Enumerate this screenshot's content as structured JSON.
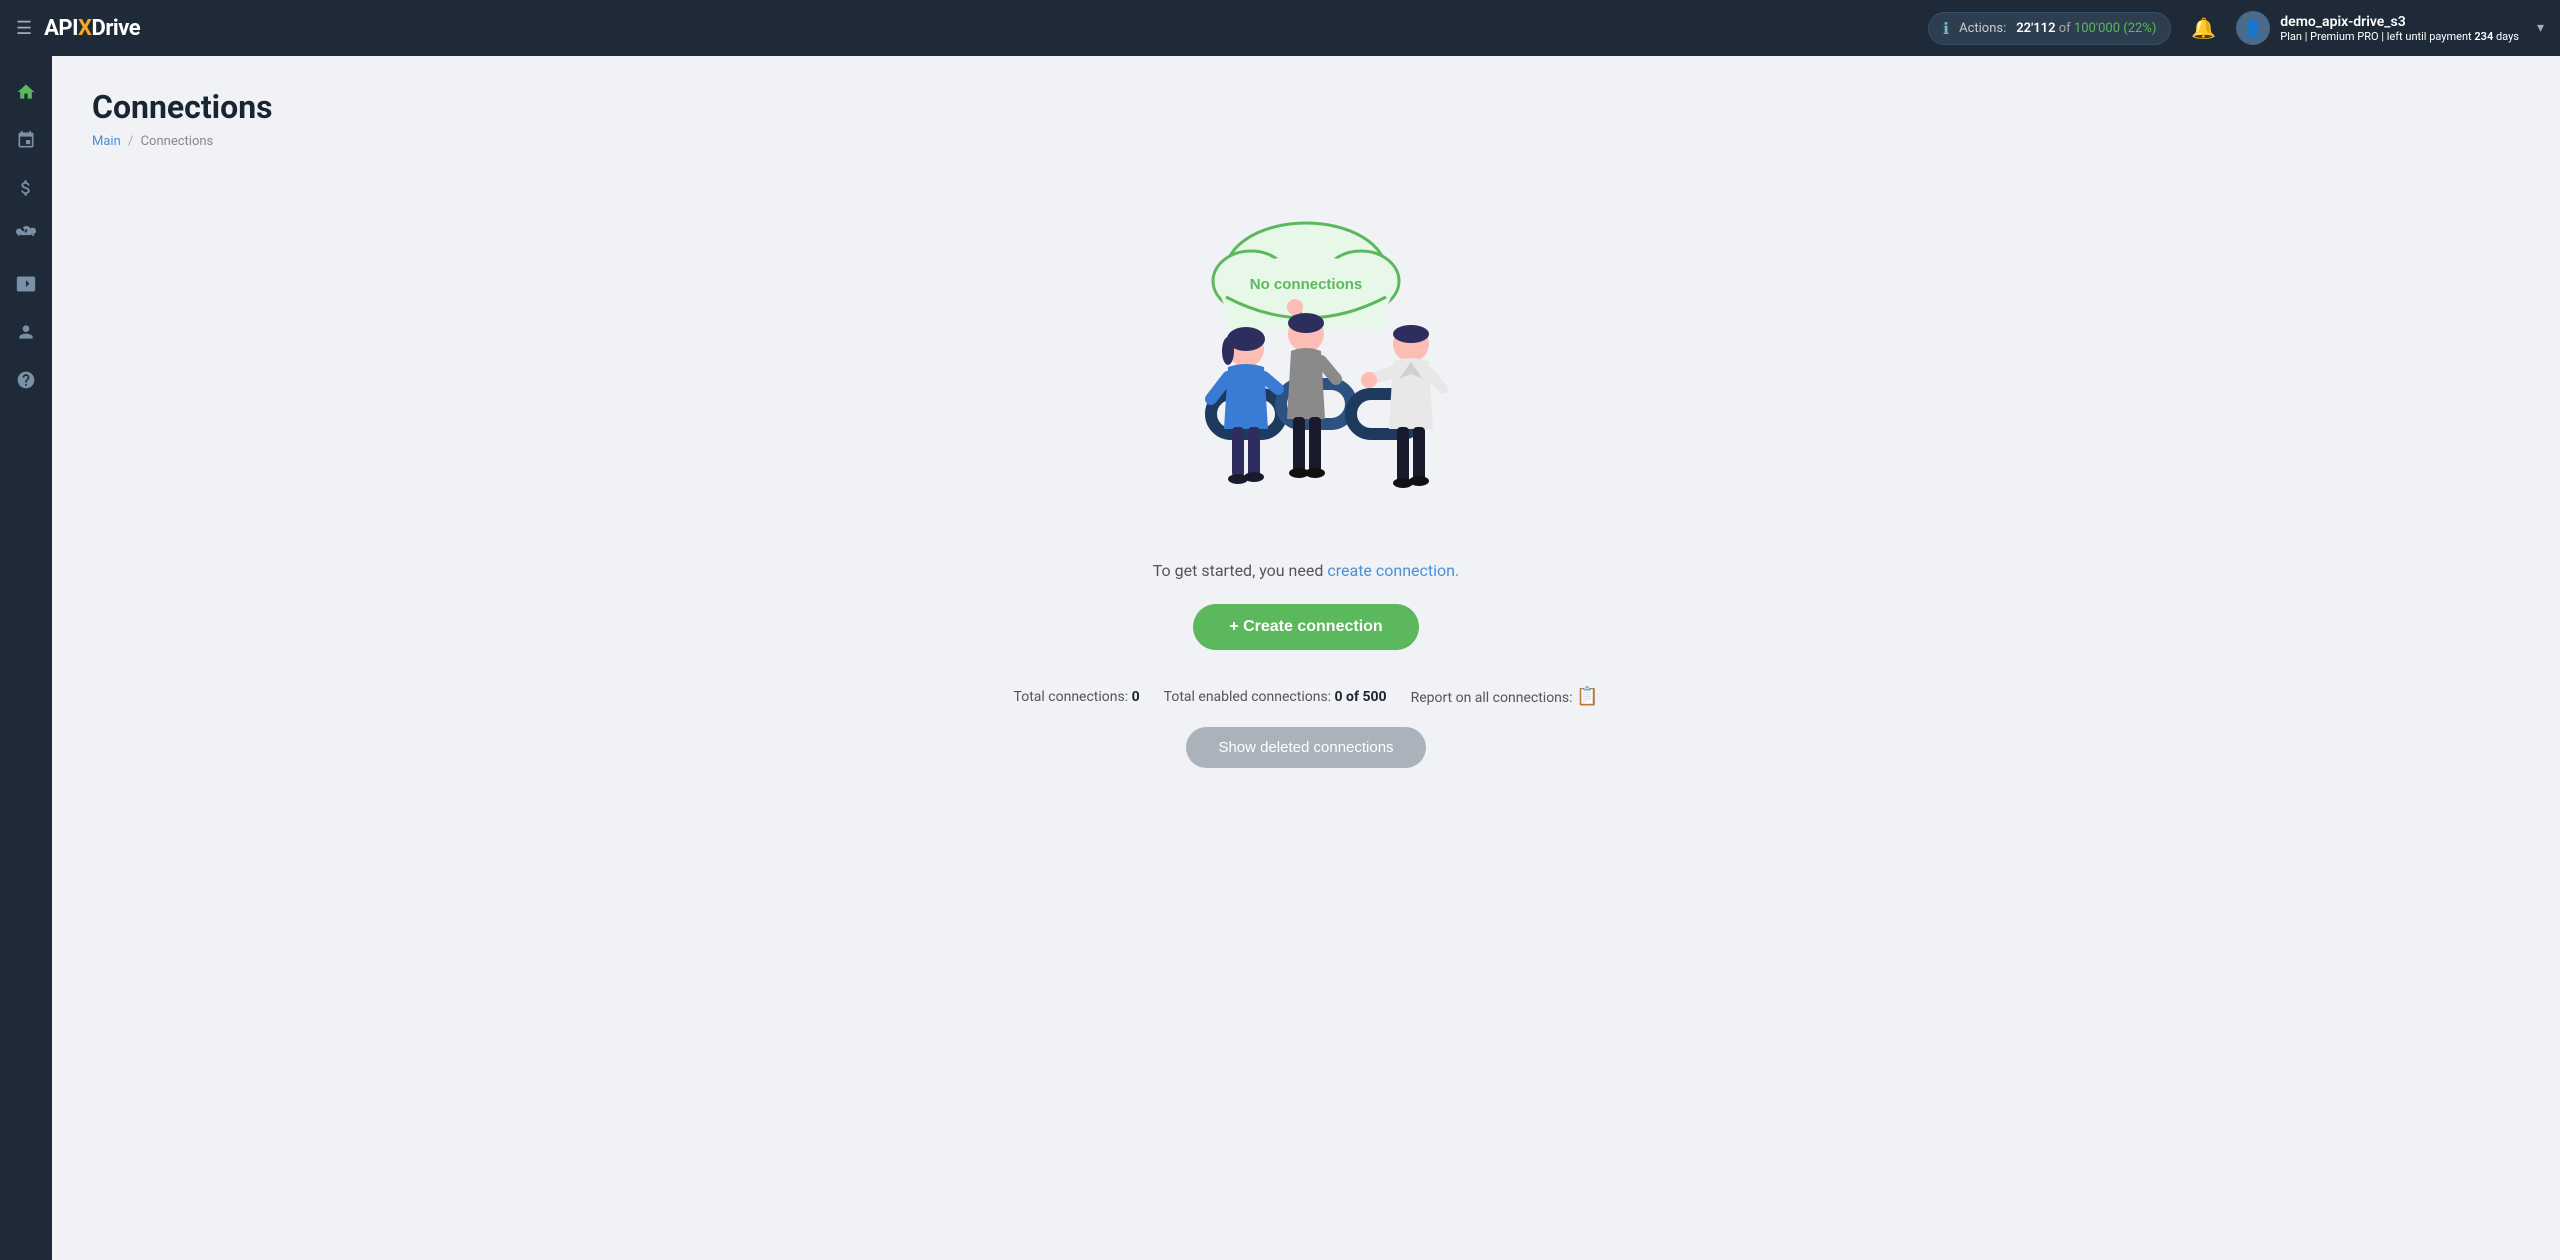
{
  "topnav": {
    "logo": {
      "api": "API",
      "x": "X",
      "drive": "Drive"
    },
    "actions": {
      "label": "Actions:",
      "current": "22'112",
      "of_text": "of",
      "total": "100'000",
      "percent": "(22%)"
    },
    "user": {
      "name": "demo_apix-drive_s3",
      "plan_prefix": "Plan |",
      "plan_name": "Premium PRO",
      "plan_suffix": "| left until payment",
      "days": "234",
      "days_suffix": "days"
    }
  },
  "sidebar": {
    "items": [
      {
        "name": "home",
        "icon": "⌂",
        "label": "Home"
      },
      {
        "name": "connections",
        "icon": "⬡",
        "label": "Connections"
      },
      {
        "name": "billing",
        "icon": "$",
        "label": "Billing"
      },
      {
        "name": "integrations",
        "icon": "🧰",
        "label": "Integrations"
      },
      {
        "name": "video",
        "icon": "▶",
        "label": "Video"
      },
      {
        "name": "profile",
        "icon": "👤",
        "label": "Profile"
      },
      {
        "name": "help",
        "icon": "?",
        "label": "Help"
      }
    ]
  },
  "page": {
    "title": "Connections",
    "breadcrumb_home": "Main",
    "breadcrumb_sep": "/",
    "breadcrumb_current": "Connections"
  },
  "illustration": {
    "cloud_text": "No connections"
  },
  "main": {
    "tagline_prefix": "To get started, you need ",
    "tagline_link": "create connection.",
    "create_button": "+ Create connection",
    "stats": {
      "total_label": "Total connections:",
      "total_value": "0",
      "enabled_label": "Total enabled connections:",
      "enabled_value": "0 of 500",
      "report_label": "Report on all connections:"
    },
    "show_deleted_button": "Show deleted connections"
  }
}
